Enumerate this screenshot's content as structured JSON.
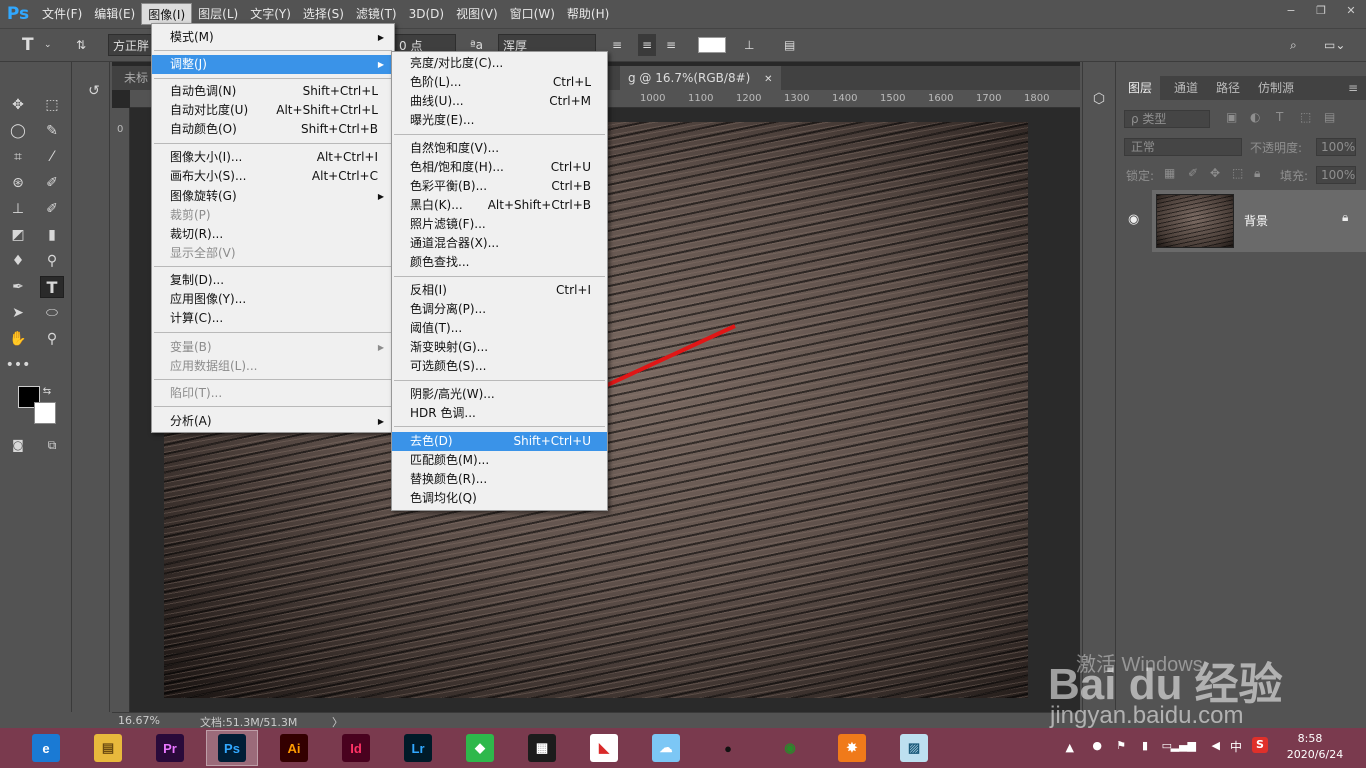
{
  "app": {
    "logo": "Ps"
  },
  "menubar": {
    "items": [
      "文件(F)",
      "编辑(E)",
      "图像(I)",
      "图层(L)",
      "文字(Y)",
      "选择(S)",
      "滤镜(T)",
      "3D(D)",
      "视图(V)",
      "窗口(W)",
      "帮助(H)"
    ],
    "window_controls": [
      "−",
      "❐",
      "✕"
    ]
  },
  "optbar": {
    "tool_icon": "T",
    "font_family": "方正胖",
    "font_size": "0 点",
    "aa_label": "ªa",
    "aa_mode": "浑厚",
    "align": [
      "left",
      "center",
      "right"
    ]
  },
  "tabs": [
    {
      "label": "未标"
    },
    {
      "label": "g @ 16.7%(RGB/8#)",
      "close": "✕"
    }
  ],
  "hruler": [
    "1000",
    "1100",
    "1200",
    "1300",
    "1400",
    "1500",
    "1600",
    "1700",
    "1800"
  ],
  "vruler_top": "0",
  "status": {
    "zoom": "16.67%",
    "doc": "文档:51.3M/51.3M",
    "arrow": "〉"
  },
  "image_menu": {
    "items": [
      {
        "label": "模式(M)",
        "arrow": "▶"
      },
      {
        "label": "调整(J)",
        "arrow": "▶",
        "highlighted": true
      },
      {
        "label": "自动色调(N)",
        "shortcut": "Shift+Ctrl+L"
      },
      {
        "label": "自动对比度(U)",
        "shortcut": "Alt+Shift+Ctrl+L"
      },
      {
        "label": "自动颜色(O)",
        "shortcut": "Shift+Ctrl+B"
      },
      {
        "label": "图像大小(I)...",
        "shortcut": "Alt+Ctrl+I"
      },
      {
        "label": "画布大小(S)...",
        "shortcut": "Alt+Ctrl+C"
      },
      {
        "label": "图像旋转(G)",
        "arrow": "▶"
      },
      {
        "label": "裁剪(P)",
        "disabled": true
      },
      {
        "label": "裁切(R)..."
      },
      {
        "label": "显示全部(V)",
        "disabled": true
      },
      {
        "label": "复制(D)..."
      },
      {
        "label": "应用图像(Y)..."
      },
      {
        "label": "计算(C)..."
      },
      {
        "label": "变量(B)",
        "arrow": "▶",
        "disabled": true
      },
      {
        "label": "应用数据组(L)...",
        "disabled": true
      },
      {
        "label": "陷印(T)...",
        "disabled": true
      },
      {
        "label": "分析(A)",
        "arrow": "▶"
      }
    ]
  },
  "adjust_menu": {
    "items": [
      {
        "label": "亮度/对比度(C)..."
      },
      {
        "label": "色阶(L)...",
        "shortcut": "Ctrl+L"
      },
      {
        "label": "曲线(U)...",
        "shortcut": "Ctrl+M"
      },
      {
        "label": "曝光度(E)..."
      },
      {
        "label": "自然饱和度(V)..."
      },
      {
        "label": "色相/饱和度(H)...",
        "shortcut": "Ctrl+U"
      },
      {
        "label": "色彩平衡(B)...",
        "shortcut": "Ctrl+B"
      },
      {
        "label": "黑白(K)...",
        "shortcut": "Alt+Shift+Ctrl+B"
      },
      {
        "label": "照片滤镜(F)..."
      },
      {
        "label": "通道混合器(X)..."
      },
      {
        "label": "颜色查找..."
      },
      {
        "label": "反相(I)",
        "shortcut": "Ctrl+I"
      },
      {
        "label": "色调分离(P)..."
      },
      {
        "label": "阈值(T)..."
      },
      {
        "label": "渐变映射(G)..."
      },
      {
        "label": "可选颜色(S)..."
      },
      {
        "label": "阴影/高光(W)..."
      },
      {
        "label": "HDR 色调..."
      },
      {
        "label": "去色(D)",
        "shortcut": "Shift+Ctrl+U",
        "highlighted": true
      },
      {
        "label": "匹配颜色(M)..."
      },
      {
        "label": "替换颜色(R)..."
      },
      {
        "label": "色调均化(Q)"
      }
    ]
  },
  "layers": {
    "tabs": [
      "图层",
      "通道",
      "路径",
      "仿制源"
    ],
    "filter_label": "ρ 类型",
    "blend_mode": "正常",
    "opacity_label": "不透明度:",
    "opacity_value": "100%",
    "lock_label": "锁定:",
    "fill_label": "填充:",
    "fill_value": "100%",
    "layer_name": "背景"
  },
  "taskbar": {
    "apps": [
      {
        "name": "browser",
        "label": "e",
        "bg": "#1a7ad4",
        "fg": "#ffffff"
      },
      {
        "name": "explorer",
        "label": "▤",
        "bg": "#e8b93c",
        "fg": "#6a4a10"
      },
      {
        "name": "premiere",
        "label": "Pr",
        "bg": "#2a0a3a",
        "fg": "#ea77ff"
      },
      {
        "name": "photoshop",
        "label": "Ps",
        "bg": "#001e36",
        "fg": "#31a8ff",
        "active": true
      },
      {
        "name": "illustrator",
        "label": "Ai",
        "bg": "#330000",
        "fg": "#ff9a00"
      },
      {
        "name": "indesign",
        "label": "Id",
        "bg": "#49021f",
        "fg": "#ff3366"
      },
      {
        "name": "lightroom",
        "label": "Lr",
        "bg": "#001a28",
        "fg": "#31a8ff"
      },
      {
        "name": "app-green",
        "label": "◆",
        "bg": "#2eb84b",
        "fg": "#ffffff"
      },
      {
        "name": "video-editor",
        "label": "▦",
        "bg": "#1c1c1c",
        "fg": "#ffffff"
      },
      {
        "name": "app-redgreen",
        "label": "◣",
        "bg": "#ffffff",
        "fg": "#d92a2a"
      },
      {
        "name": "app-cloud",
        "label": "☁",
        "bg": "#7cc7f5",
        "fg": "#ffffff"
      },
      {
        "name": "qq",
        "label": "●",
        "bg": "transparent",
        "fg": "#111111"
      },
      {
        "name": "chrome",
        "label": "◉",
        "bg": "transparent",
        "fg": "#2a8a2a"
      },
      {
        "name": "app-orange",
        "label": "✸",
        "bg": "#f07a1a",
        "fg": "#ffffff"
      },
      {
        "name": "notes",
        "label": "▨",
        "bg": "#bde0f0",
        "fg": "#1a5a7a"
      }
    ],
    "tray": {
      "ime": "中",
      "time": "8:58",
      "date": "2020/6/24"
    }
  },
  "watermark": {
    "activate": "激活 Windows",
    "baidu": "Bai du 经验",
    "url": "jingyan.baidu.com"
  },
  "colors": {
    "accent": "#3a93e8",
    "arrow": "#e01616"
  }
}
